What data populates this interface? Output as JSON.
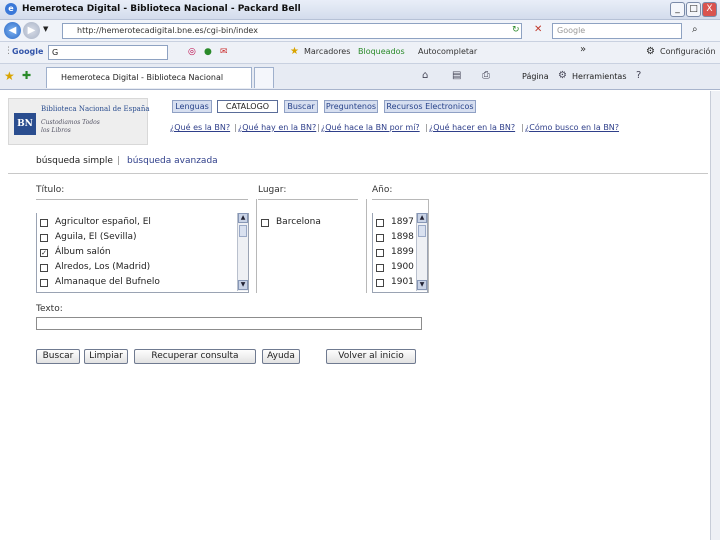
{
  "window": {
    "title": "Hemeroteca Digital - Biblioteca Nacional - Packard Bell",
    "min_label": "_",
    "max_label": "□",
    "close_label": "X"
  },
  "address_bar": {
    "url": "http://hemerotecadigital.bne.es/cgi-bin/index",
    "search_placeholder": "Google"
  },
  "google_toolbar": {
    "label": "Google",
    "dropdown_value": "G",
    "items": [
      "Marcadores",
      "Bloqueados",
      "Autocompletar",
      "Configuración"
    ],
    "more": "»"
  },
  "tabs": [
    {
      "label": "Hemeroteca Digital - Biblioteca Nacional"
    }
  ],
  "command_bar": {
    "page_label": "Página",
    "tools_label": "Herramientas"
  },
  "logo": {
    "badge": "BN",
    "line1": "Biblioteca Nacional de España",
    "line2": "Custodiamos Todos los Libros"
  },
  "nav": [
    "Lenguas",
    "CATALOGO",
    "Buscar",
    "Preguntenos",
    "Recursos Electronicos"
  ],
  "questions": [
    "¿Qué es la BN?",
    "¿Qué hay en la BN?",
    "¿Qué hace la BN por mí?",
    "¿Qué hacer en la BN?",
    "¿Cómo busco en la BN?"
  ],
  "search_modes": {
    "simple": "búsqueda simple",
    "separator": "|",
    "advanced": "búsqueda avanzada"
  },
  "fields": {
    "titulo_label": "Título:",
    "lugar_label": "Lugar:",
    "anio_label": "Año:",
    "texto_label": "Texto:"
  },
  "titulo_items": [
    {
      "label": "Agricultor español, El",
      "checked": false
    },
    {
      "label": "Aguila, El (Sevilla)",
      "checked": false
    },
    {
      "label": "Álbum salón",
      "checked": true
    },
    {
      "label": "Alredos, Los (Madrid)",
      "checked": false
    },
    {
      "label": "Almanaque del Bufnelo",
      "checked": false
    }
  ],
  "lugar_items": [
    {
      "label": "Barcelona",
      "checked": false
    }
  ],
  "anio_items": [
    {
      "label": "1897",
      "checked": false
    },
    {
      "label": "1898",
      "checked": false
    },
    {
      "label": "1899",
      "checked": false
    },
    {
      "label": "1900",
      "checked": false
    },
    {
      "label": "1901",
      "checked": false
    }
  ],
  "buttons": {
    "buscar": "Buscar",
    "limpiar": "Limpiar",
    "recuperar": "Recuperar consulta",
    "ayuda": "Ayuda",
    "volver": "Volver al inicio"
  },
  "colors": {
    "link": "#2f3f8a",
    "nav_bg": "#d7dff0",
    "logo_blue": "#2a4d8f"
  }
}
